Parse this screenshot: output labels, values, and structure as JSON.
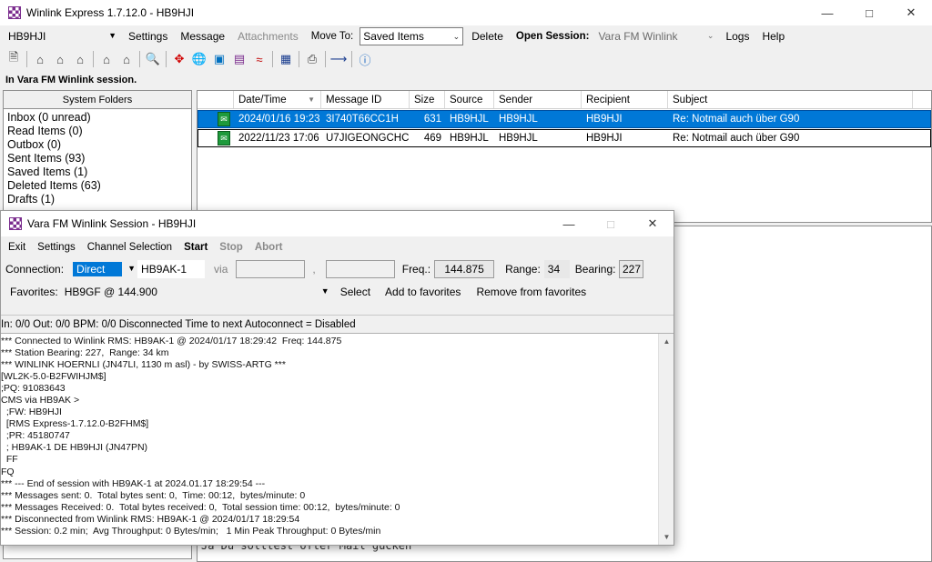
{
  "main": {
    "title": "Winlink Express 1.7.12.0 - HB9HJI",
    "callsign": "HB9HJI",
    "menu": {
      "settings": "Settings",
      "message": "Message",
      "attachments": "Attachments",
      "move_to": "Move To:",
      "move_to_value": "Saved Items",
      "delete": "Delete",
      "open_session": "Open Session:",
      "session_value": "Vara FM Winlink",
      "logs": "Logs",
      "help": "Help"
    },
    "session_status": "In Vara FM Winlink session.",
    "folders": {
      "header": "System Folders",
      "items": [
        "Inbox  (0 unread)",
        "Read Items  (0)",
        "Outbox  (0)",
        "Sent Items  (93)",
        "Saved Items  (1)",
        "Deleted Items  (63)",
        "Drafts  (1)"
      ]
    },
    "columns": [
      "Date/Time",
      "Message ID",
      "Size",
      "Source",
      "Sender",
      "Recipient",
      "Subject"
    ],
    "messages": [
      {
        "date": "2024/01/16 19:23",
        "id": "3I740T66CC1H",
        "size": "631",
        "source": "HB9HJL",
        "sender": "HB9HJL",
        "recipient": "HB9HJI",
        "subject": "Re: Notmail auch über G90"
      },
      {
        "date": "2022/11/23 17:06",
        "id": "U7JIGEONGCHC",
        "size": "469",
        "source": "HB9HJL",
        "sender": "HB9HJL",
        "recipient": "HB9HJI",
        "subject": "Re: Notmail auch über G90"
      }
    ],
    "preview_text": "Ja Du solltest ofter Mail gucken"
  },
  "session": {
    "title": "Vara FM Winlink Session - HB9HJI",
    "menu": {
      "exit": "Exit",
      "settings": "Settings",
      "channel": "Channel Selection",
      "start": "Start",
      "stop": "Stop",
      "abort": "Abort"
    },
    "connection_label": "Connection:",
    "connection_value": "Direct",
    "target": "HB9AK-1",
    "via": "via",
    "comma": ",",
    "freq_label": "Freq.:",
    "freq_value": "144.875",
    "range_label": "Range:",
    "range_value": "34",
    "bearing_label": "Bearing:",
    "bearing_value": "227",
    "favorites_label": "Favorites:",
    "favorites_value": "HB9GF  @  144.900",
    "select": "Select",
    "add_fav": "Add to favorites",
    "remove_fav": "Remove from favorites",
    "status_line": "In: 0/0  Out: 0/0  BPM: 0/0   Disconnected   Time to next Autoconnect = Disabled",
    "log": [
      "*** Connected to Winlink RMS: HB9AK-1 @ 2024/01/17 18:29:42  Freq: 144.875",
      "*** Station Bearing: 227,  Range: 34 km",
      "*** WINLINK HOERNLI (JN47LI, 1130 m asl) - by SWISS-ARTG ***",
      "[WL2K-5.0-B2FWIHJM$]",
      ";PQ: 91083643",
      "CMS via HB9AK >",
      "  ;FW: HB9HJI",
      "  [RMS Express-1.7.12.0-B2FHM$]",
      "  ;PR: 45180747",
      "  ; HB9AK-1 DE HB9HJI (JN47PN)",
      "  FF",
      "FQ",
      "*** --- End of session with HB9AK-1 at 2024.01.17 18:29:54 ---",
      "*** Messages sent: 0.  Total bytes sent: 0,  Time: 00:12,  bytes/minute: 0",
      "*** Messages Received: 0.  Total bytes received: 0,  Total session time: 00:12,  bytes/minute: 0",
      "*** Disconnected from Winlink RMS: HB9AK-1 @ 2024/01/17 18:29:54",
      "*** Session: 0.2 min;  Avg Throughput: 0 Bytes/min;   1 Min Peak Throughput: 0 Bytes/min"
    ]
  }
}
